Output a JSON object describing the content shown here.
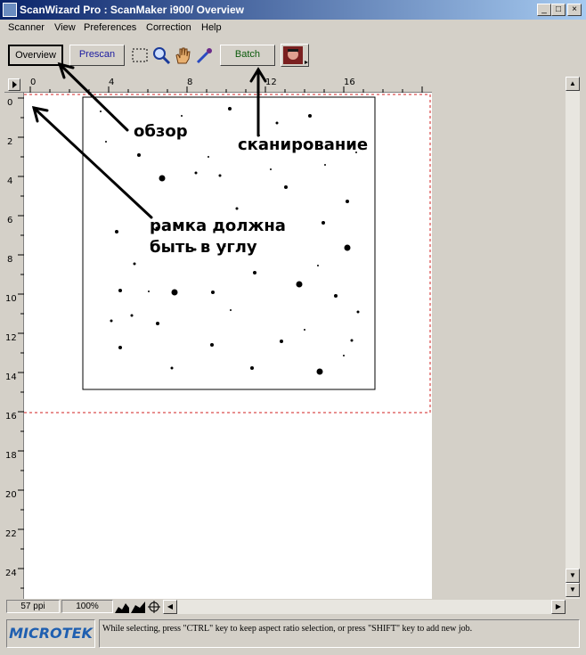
{
  "window": {
    "title": "ScanWizard Pro : ScanMaker i900/ Overview",
    "minimize": "_",
    "maximize": "□",
    "close": "×"
  },
  "menu": [
    "Scanner",
    "View",
    "Preferences",
    "Correction",
    "Help"
  ],
  "toolbar": {
    "overview_label": "Overview",
    "prescan_label": "Prescan",
    "batch_label": "Batch"
  },
  "ruler": {
    "top": [
      "0",
      "4",
      "8",
      "12",
      "16"
    ],
    "left": [
      "0",
      "2",
      "4",
      "6",
      "8",
      "10",
      "12",
      "14",
      "16",
      "18",
      "20",
      "22",
      "24"
    ]
  },
  "annotations": {
    "overview": "обзор",
    "scan": "сканирование",
    "frame_line1": "рамка должна",
    "frame_line2": "быть в углу"
  },
  "statusbar": {
    "resolution": "57 ppi",
    "zoom": "100%"
  },
  "footer": {
    "logo": "MICROTEK",
    "message": "While selecting, press \"CTRL\" key to keep aspect ratio selection, or press \"SHIFT\" key to add new job."
  }
}
